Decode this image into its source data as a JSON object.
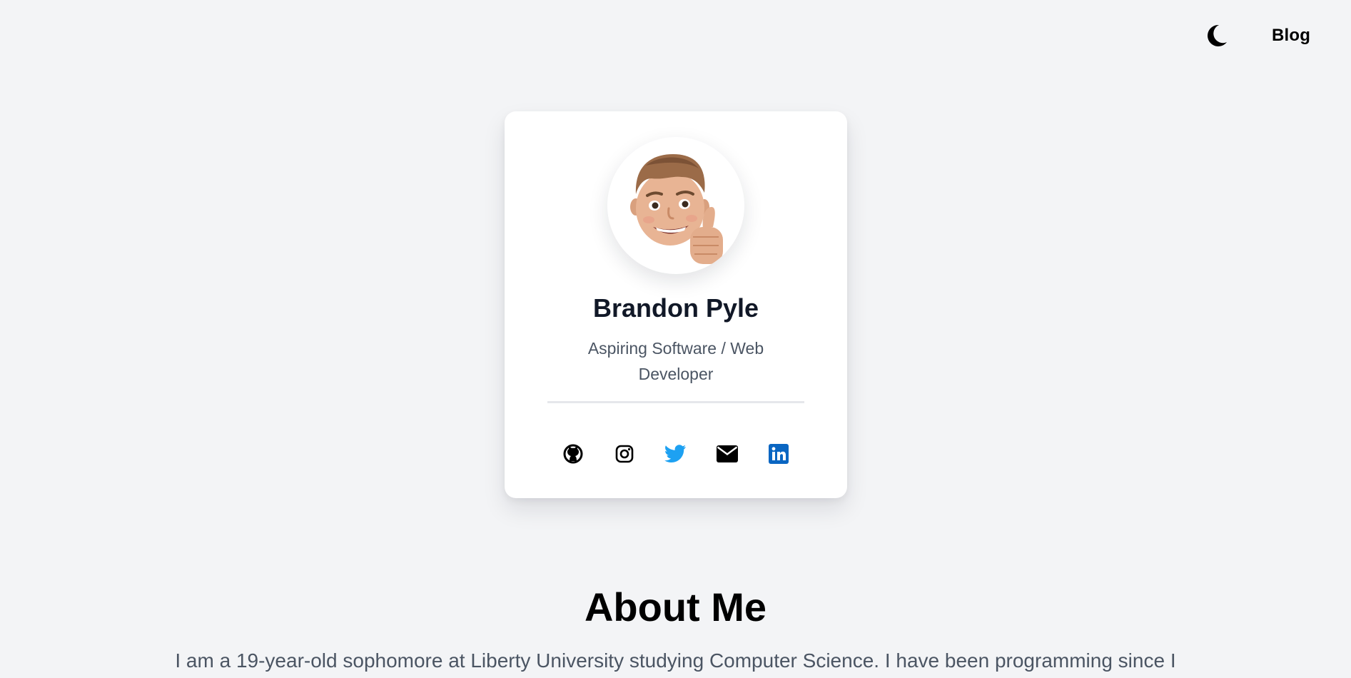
{
  "nav": {
    "theme_icon": "moon-icon",
    "blog_label": "Blog"
  },
  "profile": {
    "avatar_icon": "memoji-avatar",
    "name": "Brandon Pyle",
    "role": "Aspiring Software / Web Developer"
  },
  "socials": [
    {
      "icon": "github-icon",
      "color": "#000000"
    },
    {
      "icon": "instagram-icon",
      "color": "#000000"
    },
    {
      "icon": "twitter-icon",
      "color": "#1da1f2"
    },
    {
      "icon": "email-icon",
      "color": "#000000"
    },
    {
      "icon": "linkedin-icon",
      "color": "#0a66c2"
    }
  ],
  "about": {
    "title": "About Me",
    "text": "I am a 19-year-old sophomore at Liberty University studying Computer Science. I have been programming since I"
  },
  "colors": {
    "background": "#f3f4f6",
    "card": "#ffffff",
    "heading": "#111827",
    "muted_text": "#4b5563"
  }
}
